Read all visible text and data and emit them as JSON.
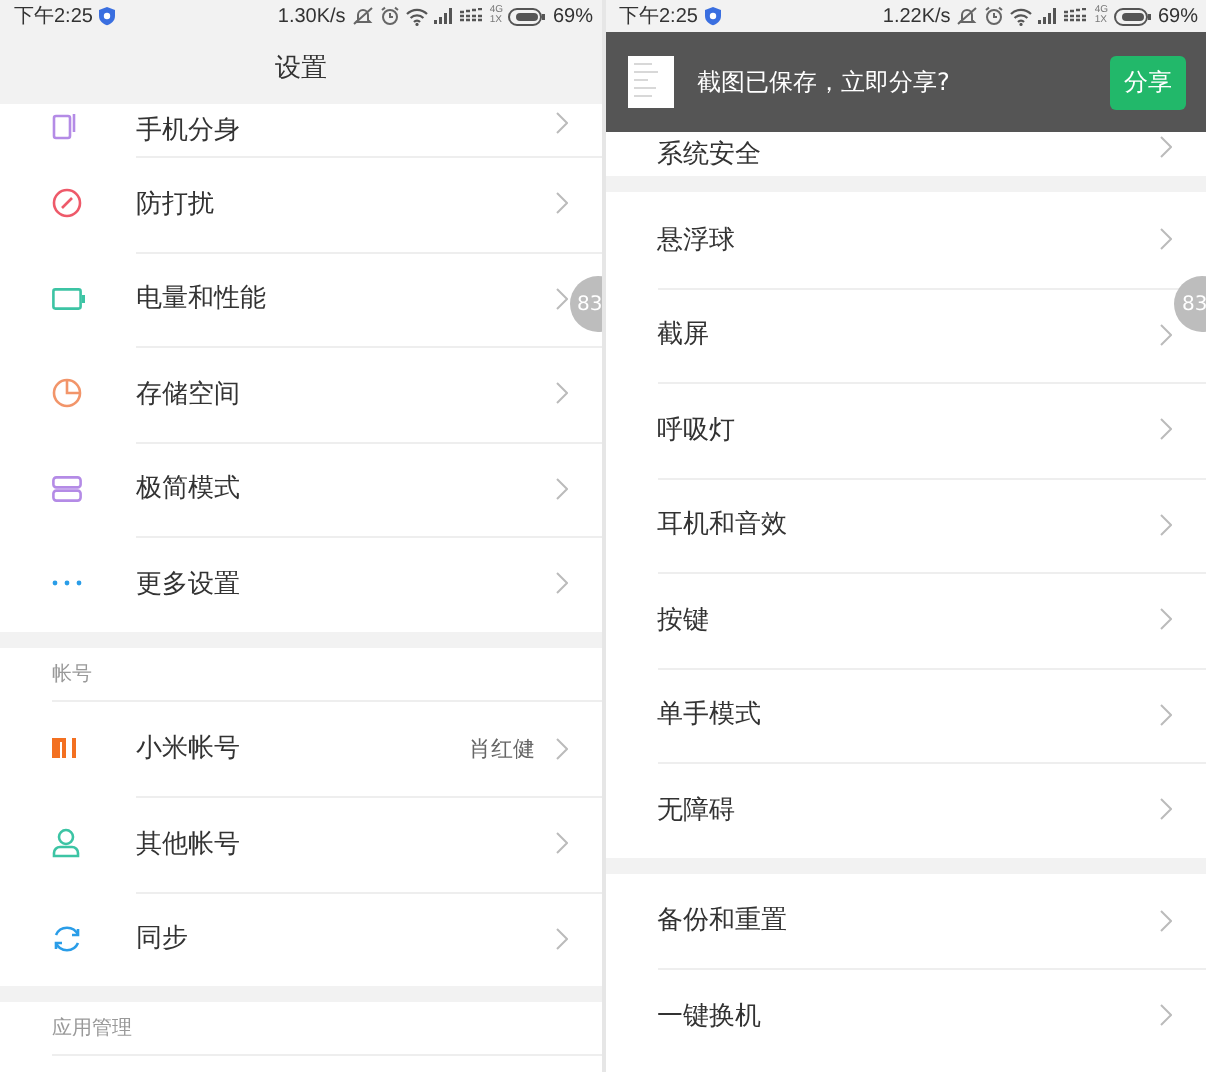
{
  "panels": [
    {
      "status_bar": {
        "time": "下午2:25",
        "speed": "1.30K/s",
        "net_top": "4G",
        "net_bottom": "1X",
        "battery": "69%"
      },
      "title": "设置",
      "float_badge": "83",
      "sections": [
        {
          "items": [
            {
              "label": "手机分身",
              "kind": "icon"
            },
            {
              "label": "防打扰",
              "kind": "icon"
            },
            {
              "label": "电量和性能",
              "kind": "icon"
            },
            {
              "label": "存储空间",
              "kind": "icon"
            },
            {
              "label": "极简模式",
              "kind": "icon"
            },
            {
              "label": "更多设置",
              "kind": "icon"
            }
          ]
        },
        {
          "header": "帐号",
          "items": [
            {
              "label": "小米帐号",
              "kind": "icon",
              "value": "肖红健"
            },
            {
              "label": "其他帐号",
              "kind": "icon"
            },
            {
              "label": "同步",
              "kind": "icon"
            }
          ]
        },
        {
          "header": "应用管理"
        }
      ]
    },
    {
      "status_bar": {
        "time": "下午2:25",
        "speed": "1.22K/s",
        "net_top": "4G",
        "net_bottom": "1X",
        "battery": "69%"
      },
      "float_badge": "83",
      "share_toast": {
        "message": "截图已保存，立即分享?",
        "button": "分享"
      },
      "sections": [
        {
          "items": [
            {
              "label": "系统安全",
              "kind": "plain"
            }
          ]
        },
        {
          "items": [
            {
              "label": "悬浮球",
              "kind": "plain"
            },
            {
              "label": "截屏",
              "kind": "plain"
            },
            {
              "label": "呼吸灯",
              "kind": "plain"
            },
            {
              "label": "耳机和音效",
              "kind": "plain"
            },
            {
              "label": "按键",
              "kind": "plain"
            },
            {
              "label": "单手模式",
              "kind": "plain"
            },
            {
              "label": "无障碍",
              "kind": "plain"
            }
          ]
        },
        {
          "items": [
            {
              "label": "备份和重置",
              "kind": "plain"
            },
            {
              "label": "一键换机",
              "kind": "plain"
            }
          ]
        }
      ]
    }
  ]
}
